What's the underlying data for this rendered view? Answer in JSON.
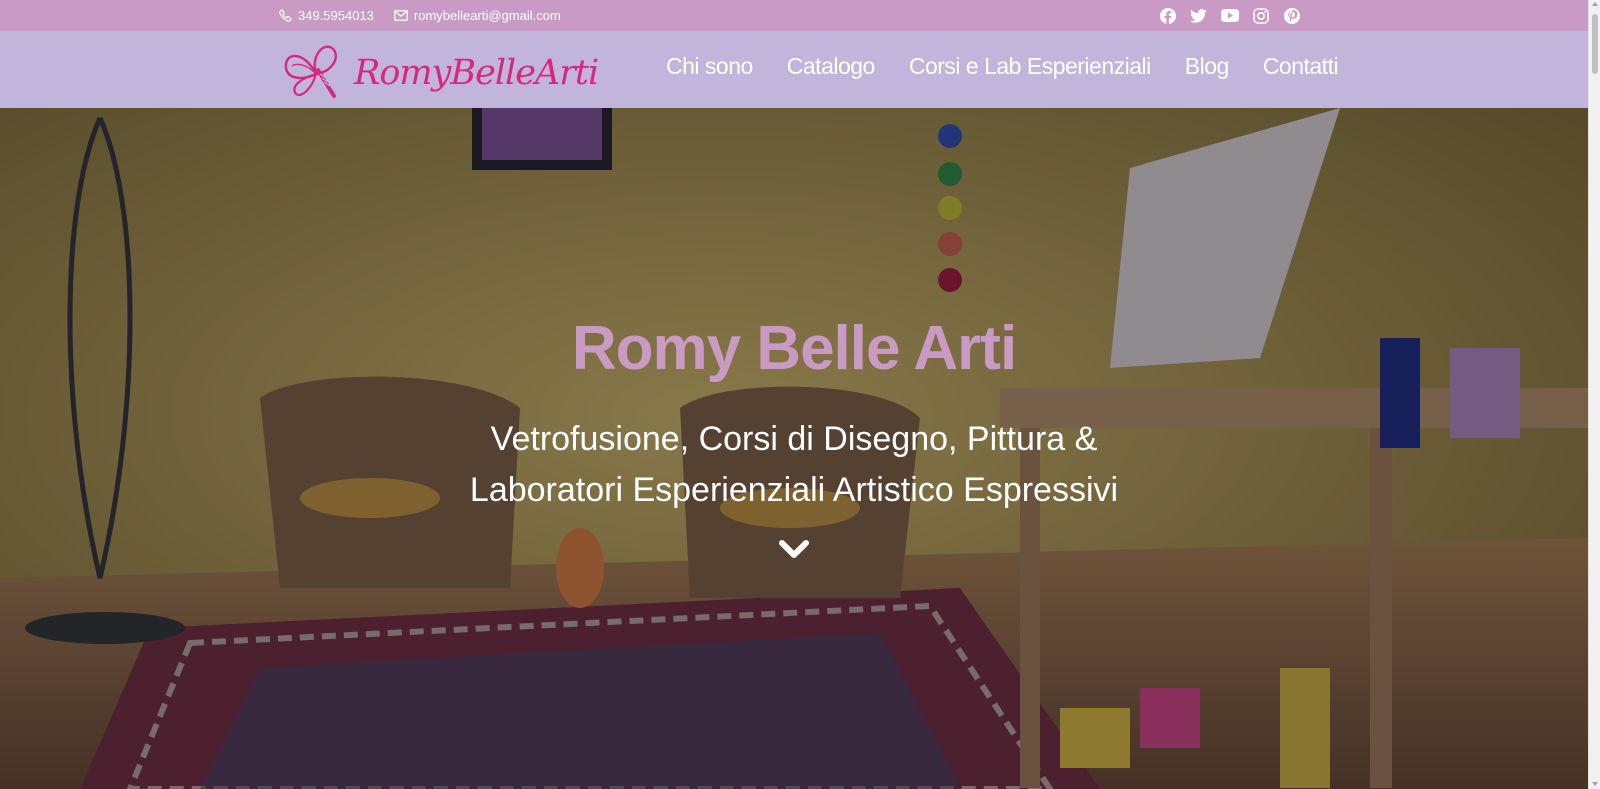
{
  "topbar": {
    "phone": "349.5954013",
    "email": "romybellearti@gmail.com",
    "socials": [
      "facebook-icon",
      "twitter-icon",
      "youtube-icon",
      "instagram-icon",
      "pinterest-icon"
    ]
  },
  "header": {
    "logo_text": "RomyBelleArti",
    "nav": [
      "Chi sono",
      "Catalogo",
      "Corsi e Lab Esperienziali",
      "Blog",
      "Contatti"
    ]
  },
  "hero": {
    "title": "Romy Belle Arti",
    "subtitle_line1": "Vetrofusione, Corsi di Disegno, Pittura &",
    "subtitle_line2": "Laboratori Esperienziali Artistico Espressivi",
    "scroll_icon": "chevron-down-icon"
  },
  "colors": {
    "topbar": "#c99bc4",
    "navbar": "#c2b5dc",
    "logo": "#d6287e",
    "title": "#c99bc4"
  }
}
